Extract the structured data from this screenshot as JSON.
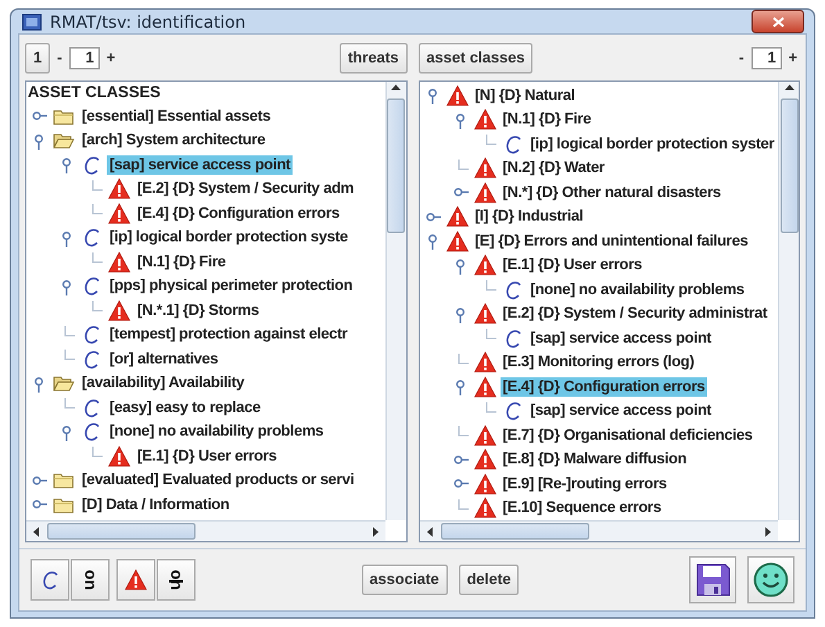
{
  "window": {
    "title": "RMAT/tsv: identification"
  },
  "left_pane": {
    "level_button": "1",
    "spinner": {
      "minus": "-",
      "value": "1",
      "plus": "+"
    },
    "switch_button": "threats",
    "tree": {
      "heading": "ASSET CLASSES",
      "items": [
        {
          "kind": "folder",
          "label": "[essential] Essential assets",
          "expanded": false,
          "selected": false
        },
        {
          "kind": "folder",
          "label": "[arch] System architecture",
          "expanded": true,
          "selected": false,
          "children": [
            {
              "kind": "class",
              "label": "[sap] service access point",
              "expanded": true,
              "selected": true,
              "children": [
                {
                  "kind": "threat",
                  "label": "[E.2] {D} System / Security adm",
                  "selected": false
                },
                {
                  "kind": "threat",
                  "label": "[E.4] {D} Configuration errors",
                  "selected": false
                }
              ]
            },
            {
              "kind": "class",
              "label": "[ip] logical border protection syste",
              "expanded": true,
              "selected": false,
              "children": [
                {
                  "kind": "threat",
                  "label": "[N.1] {D} Fire",
                  "selected": false
                }
              ]
            },
            {
              "kind": "class",
              "label": "[pps] physical perimeter protection",
              "expanded": true,
              "selected": false,
              "children": [
                {
                  "kind": "threat",
                  "label": "[N.*.1] {D} Storms",
                  "selected": false
                }
              ]
            },
            {
              "kind": "class",
              "label": "[tempest] protection against electr",
              "selected": false
            },
            {
              "kind": "class",
              "label": "[or] alternatives",
              "selected": false
            }
          ]
        },
        {
          "kind": "folder",
          "label": "[availability] Availability",
          "expanded": true,
          "selected": false,
          "children": [
            {
              "kind": "class",
              "label": "[easy] easy to replace",
              "selected": false
            },
            {
              "kind": "class",
              "label": "[none] no availability problems",
              "expanded": true,
              "selected": false,
              "children": [
                {
                  "kind": "threat",
                  "label": "[E.1] {D} User errors",
                  "selected": false
                }
              ]
            }
          ]
        },
        {
          "kind": "folder",
          "label": "[evaluated] Evaluated products or servi",
          "expanded": false,
          "selected": false
        },
        {
          "kind": "folder",
          "label": "[D] Data / Information",
          "expanded": false,
          "selected": false
        }
      ]
    }
  },
  "right_pane": {
    "switch_button": "asset classes",
    "spinner": {
      "minus": "-",
      "value": "1",
      "plus": "+"
    },
    "tree": {
      "items": [
        {
          "kind": "threat",
          "label": "[N] {D} Natural",
          "expanded": true,
          "selected": false,
          "children": [
            {
              "kind": "threat",
              "label": "[N.1] {D} Fire",
              "expanded": true,
              "selected": false,
              "children": [
                {
                  "kind": "class",
                  "label": "[ip] logical border protection syster",
                  "selected": false
                }
              ]
            },
            {
              "kind": "threat",
              "label": "[N.2] {D} Water",
              "selected": false
            },
            {
              "kind": "threat",
              "label": "[N.*] {D} Other natural disasters",
              "expanded": false,
              "selected": false
            }
          ]
        },
        {
          "kind": "threat",
          "label": "[I] {D} Industrial",
          "expanded": false,
          "selected": false
        },
        {
          "kind": "threat",
          "label": "[E] {D} Errors and unintentional failures",
          "expanded": true,
          "selected": false,
          "children": [
            {
              "kind": "threat",
              "label": "[E.1] {D} User errors",
              "expanded": true,
              "selected": false,
              "children": [
                {
                  "kind": "class",
                  "label": "[none] no availability problems",
                  "selected": false
                }
              ]
            },
            {
              "kind": "threat",
              "label": "[E.2] {D} System / Security administrat",
              "expanded": true,
              "selected": false,
              "children": [
                {
                  "kind": "class",
                  "label": "[sap] service access point",
                  "selected": false
                }
              ]
            },
            {
              "kind": "threat",
              "label": "[E.3] Monitoring errors (log)",
              "selected": false
            },
            {
              "kind": "threat",
              "label": "[E.4] {D} Configuration errors",
              "expanded": true,
              "selected": true,
              "children": [
                {
                  "kind": "class",
                  "label": "[sap] service access point",
                  "selected": false
                }
              ]
            },
            {
              "kind": "threat",
              "label": "[E.7] {D} Organisational deficiencies",
              "selected": false
            },
            {
              "kind": "threat",
              "label": "[E.8] {D} Malware diffusion",
              "expanded": false,
              "selected": false
            },
            {
              "kind": "threat",
              "label": "[E.9] [Re-]routing errors",
              "expanded": false,
              "selected": false
            },
            {
              "kind": "threat",
              "label": "[E.10] Sequence errors",
              "selected": false
            }
          ]
        }
      ]
    }
  },
  "toolbar": {
    "toggles": [
      {
        "kind": "class"
      },
      {
        "kind": "text",
        "label": "on"
      },
      {
        "kind": "threat"
      },
      {
        "kind": "struck",
        "label": "on"
      }
    ],
    "buttons": [
      "associate",
      "delete"
    ],
    "actions": [
      {
        "kind": "save"
      },
      {
        "kind": "smiley"
      }
    ]
  }
}
